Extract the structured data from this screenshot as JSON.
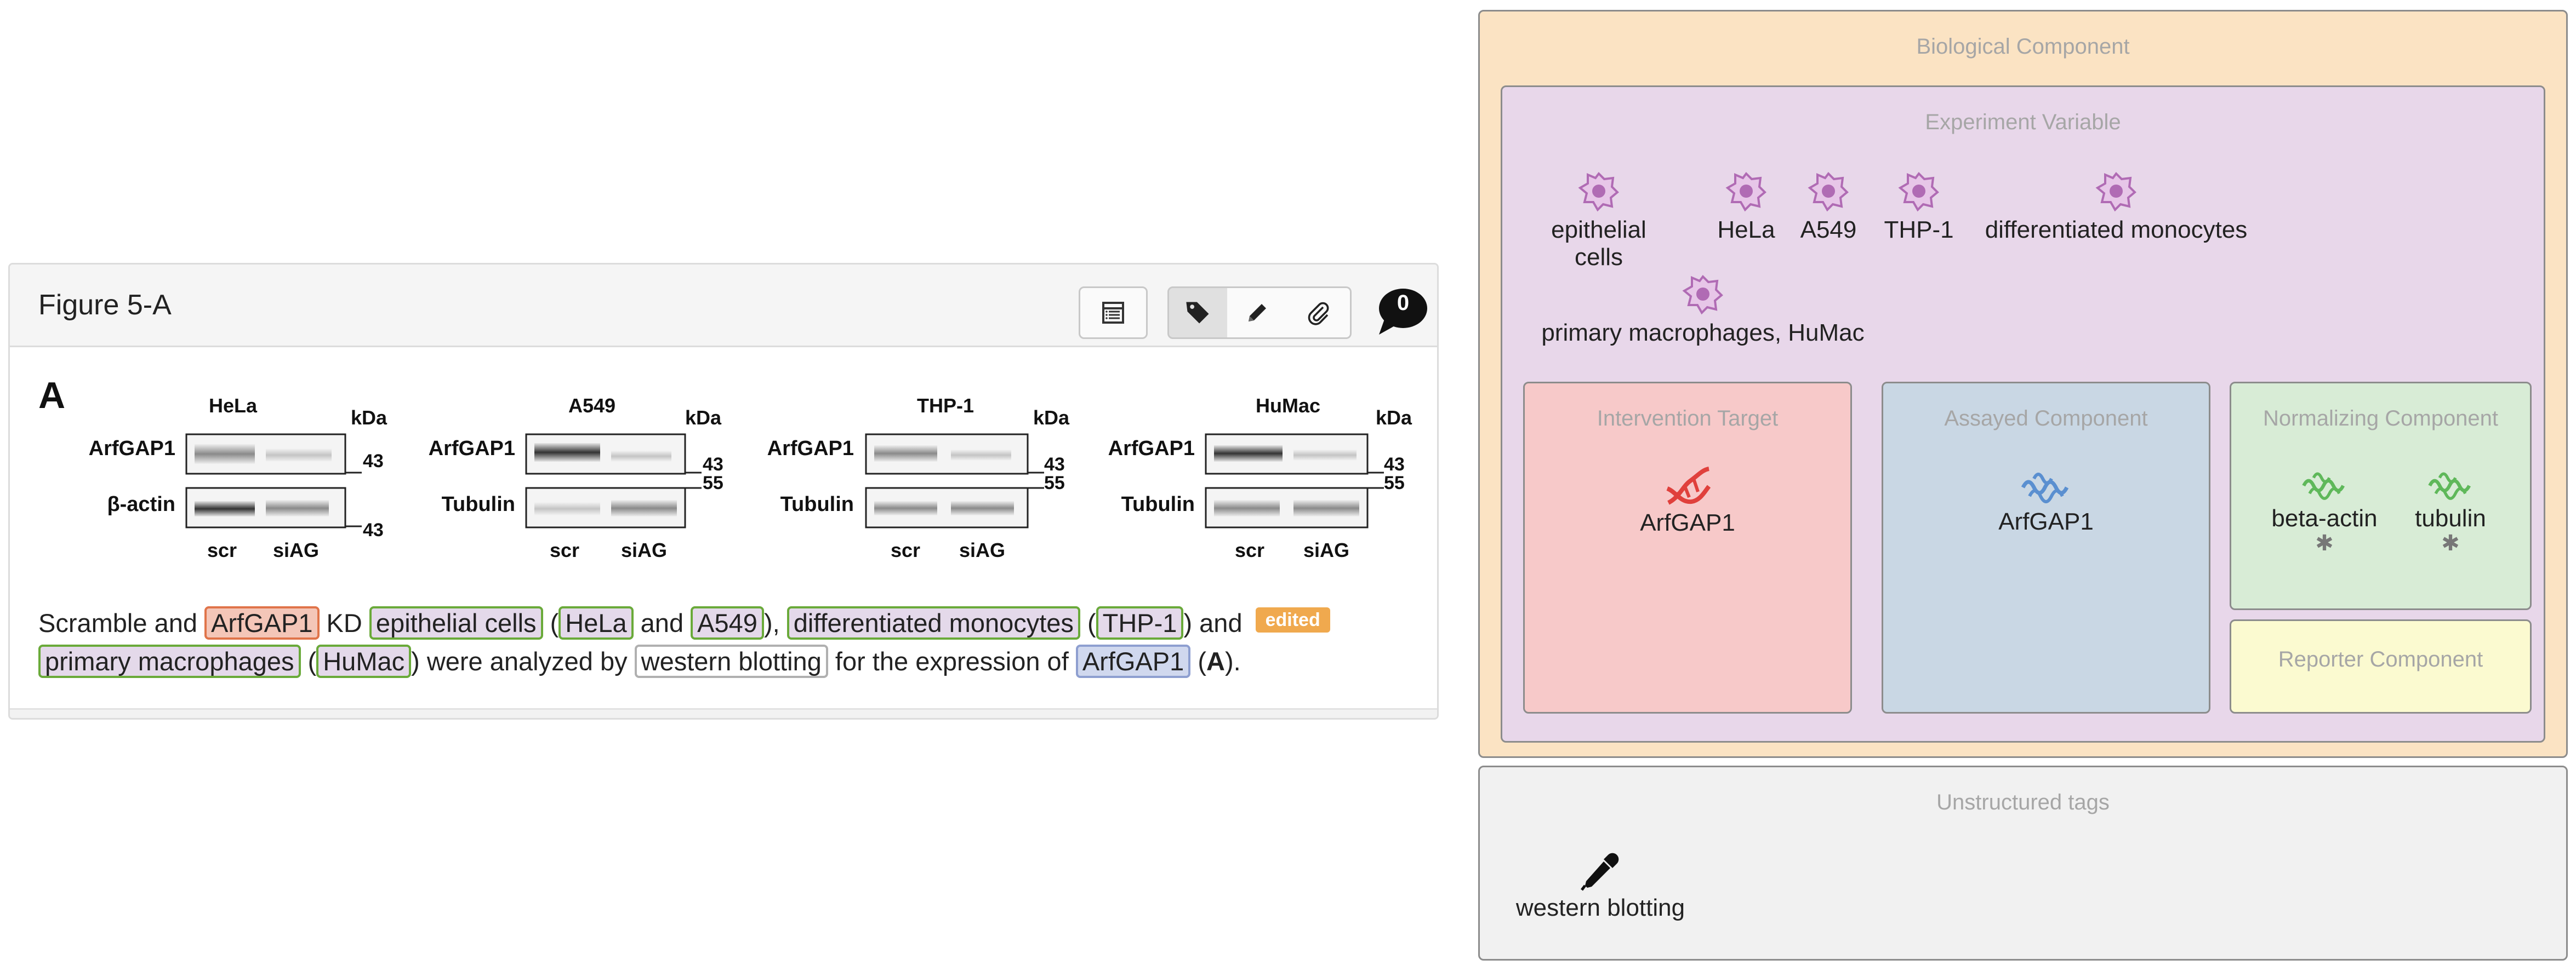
{
  "figure": {
    "title": "Figure 5-A",
    "comment_count": "0",
    "panel_letter": "A",
    "blots": [
      {
        "cell": "HeLa",
        "row1": "ArfGAP1",
        "row2": "β-actin",
        "m1": "43",
        "m2": "43",
        "lane1": "scr",
        "lane2": "siAG",
        "unit": "kDa"
      },
      {
        "cell": "A549",
        "row1": "ArfGAP1",
        "row2": "Tubulin",
        "m1": "43",
        "m2": "55",
        "lane1": "scr",
        "lane2": "siAG",
        "unit": "kDa"
      },
      {
        "cell": "THP-1",
        "row1": "ArfGAP1",
        "row2": "Tubulin",
        "m1": "43",
        "m2": "55",
        "lane1": "scr",
        "lane2": "siAG",
        "unit": "kDa"
      },
      {
        "cell": "HuMac",
        "row1": "ArfGAP1",
        "row2": "Tubulin",
        "m1": "43",
        "m2": "55",
        "lane1": "scr",
        "lane2": "siAG",
        "unit": "kDa"
      }
    ],
    "caption": {
      "t1": "Scramble and ",
      "tag_arfgap1": "ArfGAP1",
      "t2": " KD ",
      "tag_epithelial": "epithelial cells",
      "t3": " (",
      "tag_hela": "HeLa",
      "t4": " and ",
      "tag_a549": "A549",
      "t5": "), ",
      "tag_diffmono": "differentiated monocytes",
      "t6": " (",
      "tag_thp1": "THP-1",
      "t7": ") and",
      "edited": "edited",
      "tag_primary": "primary macrophages",
      "t8": " (",
      "tag_humac": "HuMac",
      "t9": ") were analyzed by ",
      "tag_western": "western blotting",
      "t10": " for the expression of ",
      "tag_arfgap1_b": "ArfGAP1",
      "t11": " (",
      "t12": "A",
      "t13": ")."
    }
  },
  "biological_component": {
    "title": "Biological Component",
    "experiment_variable": {
      "title": "Experiment Variable",
      "cells": [
        "epithelial cells",
        "HeLa",
        "A549",
        "THP-1",
        "differentiated monocytes",
        "primary macrophages, HuMac"
      ]
    },
    "intervention_target": {
      "title": "Intervention Target",
      "items": [
        "ArfGAP1"
      ]
    },
    "assayed_component": {
      "title": "Assayed Component",
      "items": [
        "ArfGAP1"
      ]
    },
    "normalizing_component": {
      "title": "Normalizing Component",
      "items": [
        "beta-actin",
        "tubulin"
      ]
    },
    "reporter_component": {
      "title": "Reporter Component"
    }
  },
  "unstructured_tags": {
    "title": "Unstructured tags",
    "items": [
      "western blotting"
    ]
  },
  "colors": {
    "cell_icon": "#b06bb4",
    "intervention_icon": "#e0403c",
    "assayed_icon": "#5a8fd0",
    "normalizing_icon": "#5fb85a",
    "edited_badge": "#f0a94e"
  }
}
